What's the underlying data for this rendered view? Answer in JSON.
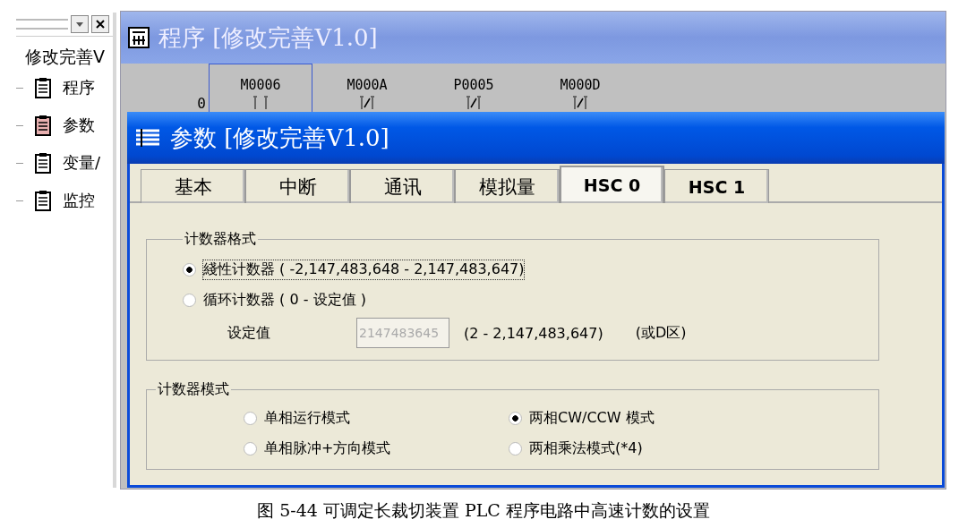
{
  "side_panel": {
    "title": "修改完善V",
    "items": [
      {
        "label": "程序",
        "selected": false
      },
      {
        "label": "参数",
        "selected": true
      },
      {
        "label": "变量/",
        "selected": false
      },
      {
        "label": "监控",
        "selected": false
      }
    ]
  },
  "program_window": {
    "title": "程序 [修改完善V1.0]",
    "rung_number": "0",
    "contacts": [
      {
        "label": "M0006",
        "kind": "normally_open",
        "selected": true
      },
      {
        "label": "M000A",
        "kind": "normally_closed",
        "selected": false
      },
      {
        "label": "P0005",
        "kind": "normally_closed",
        "selected": false
      },
      {
        "label": "M000D",
        "kind": "normally_closed",
        "selected": false
      }
    ]
  },
  "param_dialog": {
    "title": "参数 [修改完善V1.0]",
    "tabs": [
      {
        "label": "基本",
        "selected": false
      },
      {
        "label": "中断",
        "selected": false
      },
      {
        "label": "通讯",
        "selected": false
      },
      {
        "label": "模拟量",
        "selected": false
      },
      {
        "label": "HSC 0",
        "selected": true
      },
      {
        "label": "HSC 1",
        "selected": false
      }
    ],
    "counter_format": {
      "title": "计数器格式",
      "options": [
        {
          "label": "綫性计数器 ( -2,147,483,648 - 2,147,483,647)",
          "selected": true
        },
        {
          "label": "循环计数器 ( 0 - 设定值 )",
          "selected": false
        }
      ],
      "setpoint": {
        "label": "设定值",
        "value": "2147483645",
        "disabled": true,
        "range": "(2 - 2,147,483,647)",
        "note": "(或D区)"
      }
    },
    "counter_mode": {
      "title": "计数器模式",
      "options": [
        {
          "label": "单相运行模式",
          "selected": false
        },
        {
          "label": "两相CW/CCW 模式",
          "selected": true
        },
        {
          "label": "单相脉冲+方向模式",
          "selected": false
        },
        {
          "label": "两相乘法模式(*4)",
          "selected": false
        }
      ]
    }
  },
  "caption": "图 5-44 可调定长裁切装置 PLC 程序电路中高速计数的设置"
}
